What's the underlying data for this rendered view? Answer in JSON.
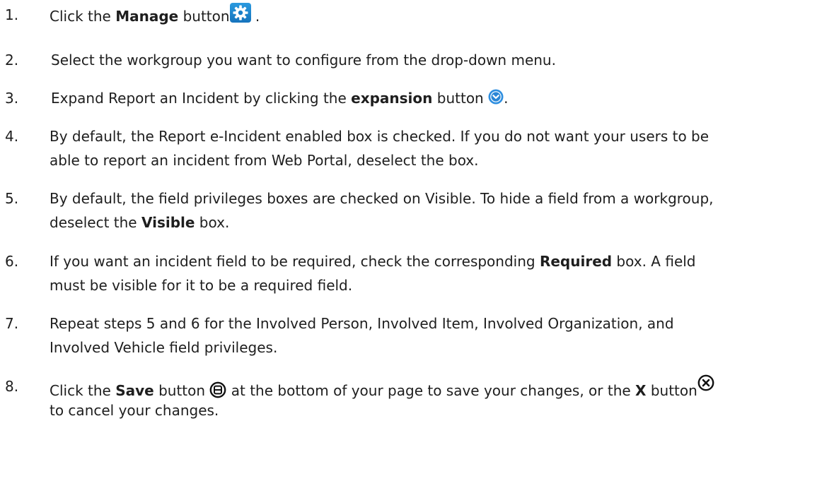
{
  "steps": [
    {
      "num": "1.",
      "pre": "Click the ",
      "bold": "Manage",
      "post": " button",
      "tail": " ."
    },
    {
      "num": "2.",
      "text": "Select the workgroup you want to configure from the drop-down menu."
    },
    {
      "num": "3.",
      "pre": "Expand Report an Incident by clicking the ",
      "bold": "expansion",
      "post": " button ",
      "tail": "."
    },
    {
      "num": "4.",
      "line1": "By default, the Report e-Incident enabled box is checked. If you do not want your users to be",
      "line2": "able to report an incident from Web Portal, deselect the box."
    },
    {
      "num": "5.",
      "line1": "By default, the field privileges boxes are checked on Visible. To hide a field from a workgroup,",
      "line2_pre": "deselect the ",
      "line2_bold": "Visible",
      "line2_post": " box."
    },
    {
      "num": "6.",
      "line1_pre": "If you want an incident field to be required, check the corresponding ",
      "line1_bold": "Required",
      "line1_post": " box. A field",
      "line2": "must be visible for it to be a required field."
    },
    {
      "num": "7.",
      "line1": "Repeat steps 5 and 6 for the Involved Person, Involved Item, Involved Organization, and",
      "line2": "Involved Vehicle field privileges."
    },
    {
      "num": "8.",
      "line1_pre": "Click the ",
      "line1_bold": "Save",
      "line1_mid": " button ",
      "line1_mid2": " at the bottom of your page to save your changes, or the ",
      "line1_bold2": "X",
      "line1_post": " button",
      "line2": "to cancel your changes."
    }
  ],
  "icons": {
    "manage": "gear-icon",
    "expansion": "chevron-down-circle-icon",
    "save": "save-circle-icon",
    "cancel": "close-circle-icon"
  },
  "colors": {
    "manage_bg": "#1a82cc",
    "expansion_blue": "#1f7fd0"
  }
}
